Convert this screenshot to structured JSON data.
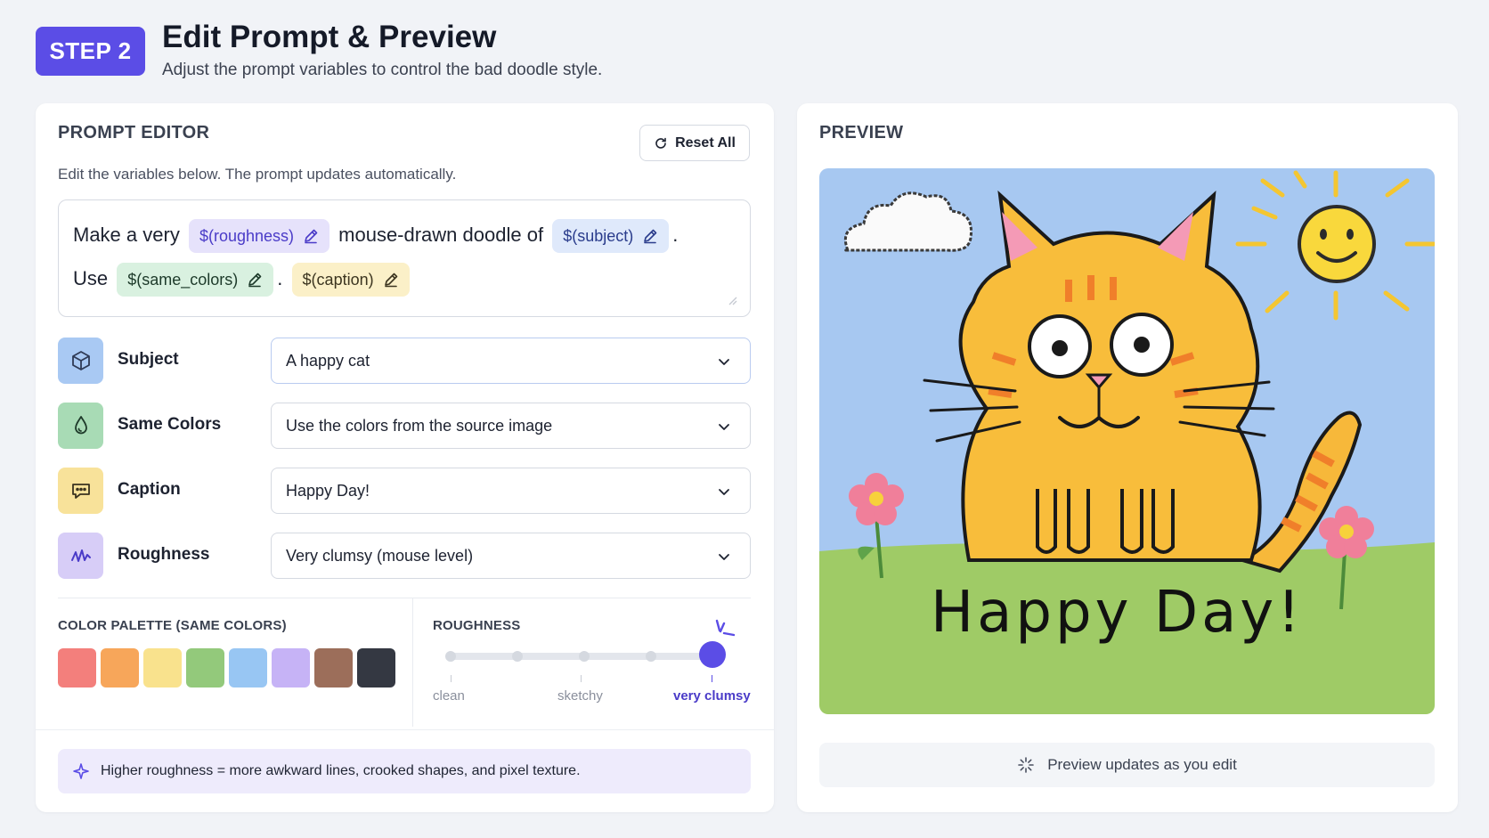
{
  "header": {
    "step_badge": "STEP 2",
    "title": "Edit Prompt & Preview",
    "subtitle": "Adjust the prompt variables to control the bad doodle style."
  },
  "editor": {
    "title": "PROMPT EDITOR",
    "reset_label": "Reset All",
    "description": "Edit the variables below. The prompt updates automatically.",
    "prompt": {
      "text_1": "Make a very",
      "var_roughness": "$(roughness)",
      "text_2": "mouse-drawn doodle of",
      "var_subject": "$(subject)",
      "text_3": ".",
      "text_4": "Use",
      "var_same_colors": "$(same_colors)",
      "text_5": ".",
      "var_caption": "$(caption)"
    },
    "fields": [
      {
        "label": "Subject",
        "value": "A happy cat",
        "icon": "cube-icon",
        "color": "#a9c9f3"
      },
      {
        "label": "Same Colors",
        "value": "Use the colors from the source image",
        "icon": "droplet-icon",
        "color": "#a8dbb5"
      },
      {
        "label": "Caption",
        "value": "Happy Day!",
        "icon": "speech-bubble-icon",
        "color": "#f8e29a"
      },
      {
        "label": "Roughness",
        "value": "Very clumsy (mouse level)",
        "icon": "squiggle-icon",
        "color": "#d7cdf7"
      }
    ],
    "palette": {
      "label": "COLOR PALETTE (SAME COLORS)",
      "colors": [
        "#f37f7c",
        "#f7a65a",
        "#f9e28d",
        "#93c97b",
        "#98c6f3",
        "#c6b3f6",
        "#9c6e5a",
        "#343842"
      ]
    },
    "roughness": {
      "label": "ROUGHNESS",
      "stops": [
        "clean",
        "sketchy",
        "very clumsy"
      ],
      "level": 1.0
    },
    "tip": "Higher roughness = more awkward lines, crooked shapes, and pixel texture."
  },
  "preview": {
    "title": "PREVIEW",
    "caption_in_image": "Happy Day!",
    "status": "Preview updates as you edit"
  },
  "colors": {
    "accent": "#5b4de6"
  }
}
